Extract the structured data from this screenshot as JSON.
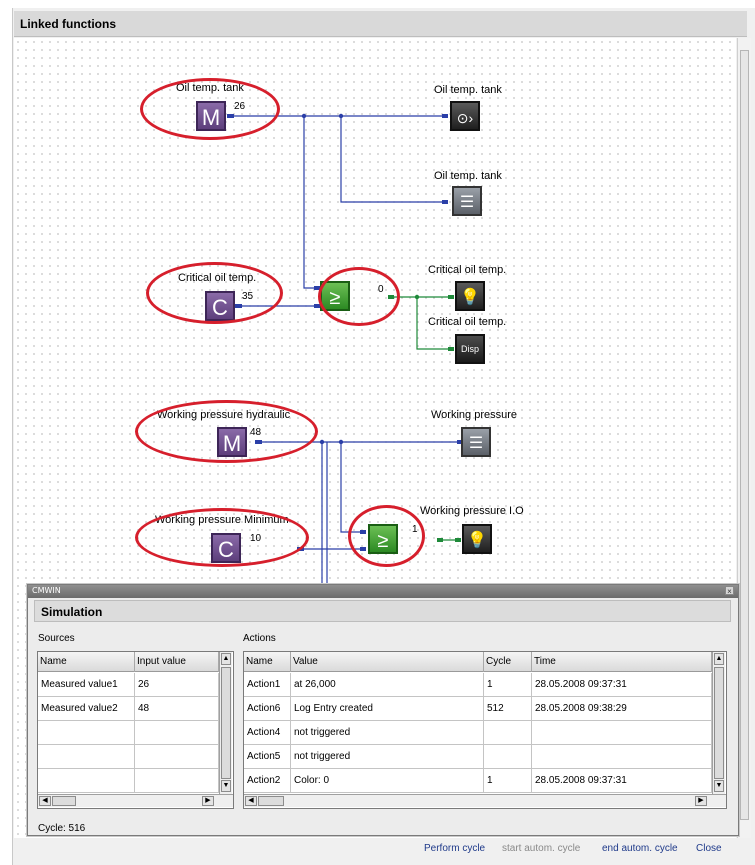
{
  "panel": {
    "title": "Linked functions"
  },
  "diagram": {
    "nodes": {
      "oil_temp_sensor": {
        "label": "Oil temp. tank",
        "letter": "M",
        "value": "26"
      },
      "oil_temp_out1": {
        "label": "Oil temp. tank",
        "icon": "analog-output-icon"
      },
      "oil_temp_out2": {
        "label": "Oil temp. tank",
        "icon": "log-list-icon"
      },
      "critical_const": {
        "label": "Critical oil temp.",
        "letter": "C",
        "value": "35"
      },
      "compare1": {
        "symbol": "≥",
        "value": "0"
      },
      "critical_lamp": {
        "label": "Critical oil temp.",
        "icon": "lamp-icon"
      },
      "critical_disp": {
        "label": "Critical oil temp.",
        "text": "Disp"
      },
      "pressure_sensor": {
        "label": "Working pressure hydraulic",
        "letter": "M",
        "value": "48"
      },
      "pressure_log": {
        "label": "Working pressure",
        "icon": "log-list-icon"
      },
      "pressure_min": {
        "label": "Working pressure Minimum",
        "letter": "C",
        "value": "10"
      },
      "compare2": {
        "symbol": "≥",
        "value": "1"
      },
      "pressure_lamp": {
        "label": "Working pressure I.O",
        "icon": "lamp-icon"
      }
    },
    "colors": {
      "wire_blue": "#2b3fa8",
      "wire_green": "#1f8a3a",
      "annotation": "#d61f2c"
    }
  },
  "simulation": {
    "window_title": "CMWIN",
    "header": "Simulation",
    "sources": {
      "label": "Sources",
      "columns": [
        "Name",
        "Input value"
      ],
      "rows": [
        [
          "Measured value1",
          "26"
        ],
        [
          "Measured value2",
          "48"
        ],
        [
          "",
          ""
        ],
        [
          "",
          ""
        ],
        [
          "",
          ""
        ]
      ]
    },
    "actions": {
      "label": "Actions",
      "columns": [
        "Name",
        "Value",
        "Cycle",
        "Time"
      ],
      "rows": [
        [
          "Action1",
          " at 26,000",
          "1",
          "28.05.2008 09:37:31"
        ],
        [
          "Action6",
          "Log Entry created",
          "512",
          "28.05.2008 09:38:29"
        ],
        [
          "Action4",
          "not triggered",
          "",
          ""
        ],
        [
          "Action5",
          "not triggered",
          "",
          ""
        ],
        [
          "Action2",
          "Color: 0",
          "1",
          "28.05.2008 09:37:31"
        ]
      ]
    },
    "cycle_text": "Cycle: 516",
    "buttons": {
      "perform": "Perform cycle",
      "start_auto": "start autom. cycle",
      "end_auto": "end autom. cycle",
      "close": "Close"
    }
  }
}
